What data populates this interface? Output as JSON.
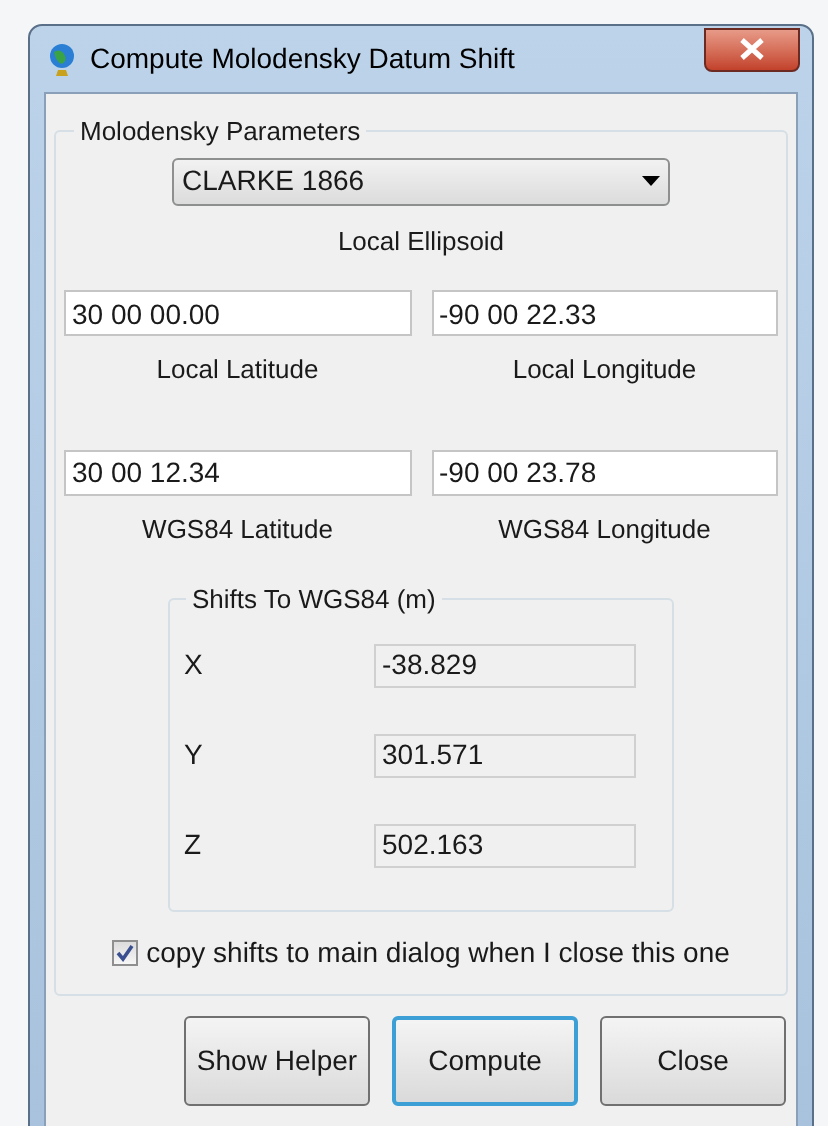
{
  "window": {
    "title": "Compute Molodensky Datum Shift"
  },
  "parameters": {
    "title": "Molodensky Parameters",
    "ellipsoid": {
      "value": "CLARKE 1866",
      "label": "Local Ellipsoid"
    },
    "coordinates": [
      {
        "value": "30 00 00.00",
        "label": "Local Latitude"
      },
      {
        "value": "-90 00 22.33",
        "label": "Local Longitude"
      },
      {
        "value": "30 00 12.34",
        "label": "WGS84 Latitude"
      },
      {
        "value": "-90 00 23.78",
        "label": "WGS84 Longitude"
      }
    ],
    "shifts": {
      "title": "Shifts To WGS84 (m)",
      "rows": [
        {
          "label": "X",
          "value": "-38.829"
        },
        {
          "label": "Y",
          "value": "301.571"
        },
        {
          "label": "Z",
          "value": "502.163"
        }
      ]
    },
    "copy_option": {
      "label": "copy shifts to main dialog when I close this one",
      "checked": true
    }
  },
  "buttons": [
    {
      "label": "Show Helper",
      "focused": false
    },
    {
      "label": "Compute",
      "focused": true
    },
    {
      "label": "Close",
      "focused": false
    }
  ]
}
